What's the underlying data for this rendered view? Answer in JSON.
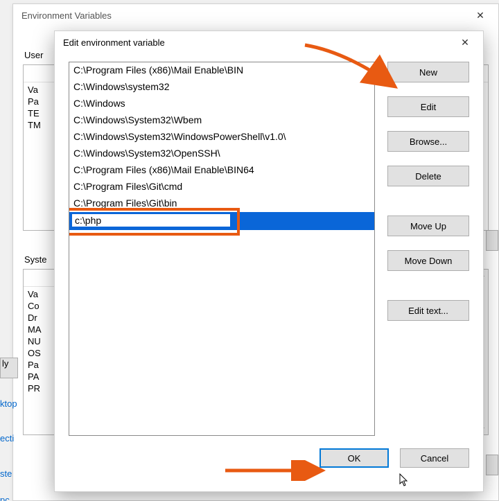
{
  "parent": {
    "title": "Environment Variables",
    "user_section_label": "User",
    "system_section_label": "Syste",
    "col_variable_hint": "Va",
    "user_vars": [
      "Va",
      "Pa",
      "TE",
      "TM"
    ],
    "system_vars": [
      "Va",
      "Co",
      "Dr",
      "MA",
      "NU",
      "OS",
      "Pa",
      "PA",
      "PR"
    ],
    "left_links": {
      "ktop": "ktop",
      "ecti": "ecti",
      "ste": "ste",
      "pc": "pc"
    },
    "apply_fragment": "ly"
  },
  "dialog": {
    "title": "Edit environment variable",
    "paths": [
      "C:\\Program Files (x86)\\Mail Enable\\BIN",
      "C:\\Windows\\system32",
      "C:\\Windows",
      "C:\\Windows\\System32\\Wbem",
      "C:\\Windows\\System32\\WindowsPowerShell\\v1.0\\",
      "C:\\Windows\\System32\\OpenSSH\\",
      "C:\\Program Files (x86)\\Mail Enable\\BIN64",
      "C:\\Program Files\\Git\\cmd",
      "C:\\Program Files\\Git\\bin"
    ],
    "editing_value": "c:\\php",
    "buttons": {
      "new": "New",
      "edit": "Edit",
      "browse": "Browse...",
      "delete": "Delete",
      "moveUp": "Move Up",
      "moveDown": "Move Down",
      "editText": "Edit text...",
      "ok": "OK",
      "cancel": "Cancel"
    }
  },
  "annotations": {
    "arrow_to_new": true,
    "arrow_to_ok": true,
    "highlight_editing": true
  }
}
